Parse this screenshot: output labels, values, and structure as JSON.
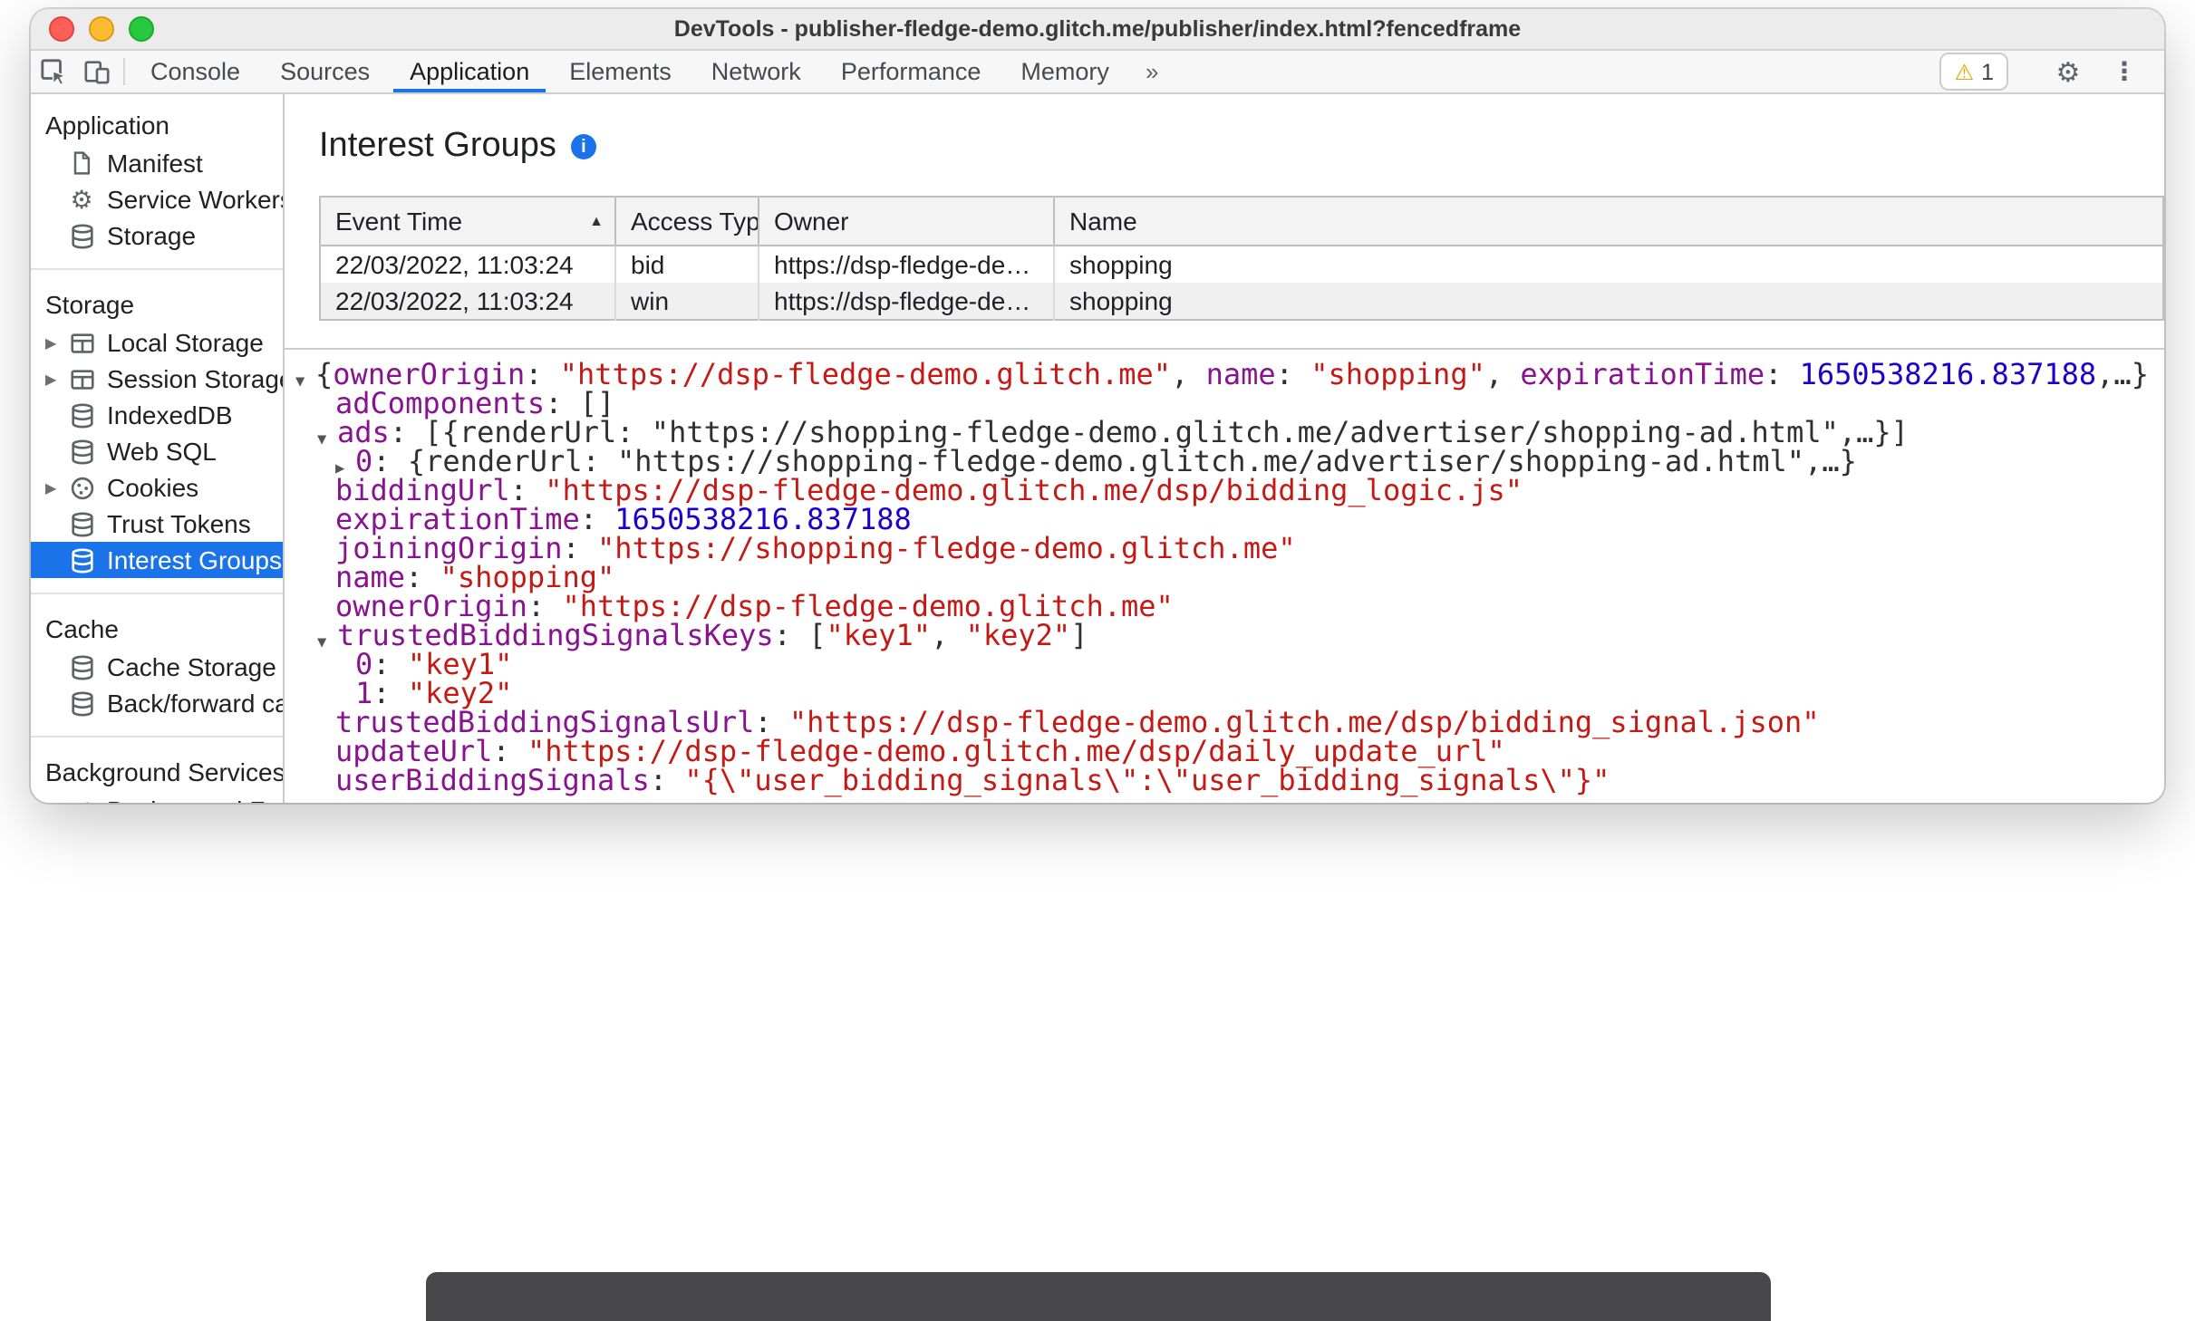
{
  "window": {
    "title": "DevTools - publisher-fledge-demo.glitch.me/publisher/index.html?fencedframe"
  },
  "toolbar": {
    "tabs": [
      "Console",
      "Sources",
      "Application",
      "Elements",
      "Network",
      "Performance",
      "Memory"
    ],
    "active_tab": "Application",
    "more_label": "»",
    "warning_count": "1"
  },
  "sidebar": {
    "sections": [
      {
        "header": "Application",
        "items": [
          {
            "label": "Manifest",
            "icon": "document"
          },
          {
            "label": "Service Workers",
            "icon": "gear"
          },
          {
            "label": "Storage",
            "icon": "database"
          }
        ]
      },
      {
        "header": "Storage",
        "items": [
          {
            "label": "Local Storage",
            "icon": "table",
            "expander": true
          },
          {
            "label": "Session Storage",
            "icon": "table",
            "expander": true
          },
          {
            "label": "IndexedDB",
            "icon": "database"
          },
          {
            "label": "Web SQL",
            "icon": "database"
          },
          {
            "label": "Cookies",
            "icon": "cookie",
            "expander": true
          },
          {
            "label": "Trust Tokens",
            "icon": "database"
          },
          {
            "label": "Interest Groups",
            "icon": "database",
            "selected": true
          }
        ]
      },
      {
        "header": "Cache",
        "items": [
          {
            "label": "Cache Storage",
            "icon": "database"
          },
          {
            "label": "Back/forward cache",
            "icon": "database"
          }
        ]
      },
      {
        "header": "Background Services",
        "items": [
          {
            "label": "Background Fetch",
            "icon": "updown"
          }
        ]
      }
    ]
  },
  "main": {
    "title": "Interest Groups",
    "table": {
      "columns": [
        "Event Time",
        "Access Type",
        "Owner",
        "Name"
      ],
      "sorted_column": "Event Time",
      "sort_indicator": "▲",
      "rows": [
        [
          "22/03/2022, 11:03:24",
          "bid",
          "https://dsp-fledge-demo.glitch.me",
          "shopping"
        ],
        [
          "22/03/2022, 11:03:24",
          "win",
          "https://dsp-fledge-demo.glitch.me",
          "shopping"
        ]
      ]
    },
    "tree": {
      "lines": [
        {
          "x": 10,
          "arrow": "v",
          "segs": [
            [
              "p",
              "{"
            ],
            [
              "k",
              "ownerOrigin"
            ],
            [
              "p",
              ": "
            ],
            [
              "s",
              "\"https://dsp-fledge-demo.glitch.me\""
            ],
            [
              "p",
              ", "
            ],
            [
              "k",
              "name"
            ],
            [
              "p",
              ": "
            ],
            [
              "s",
              "\"shopping\""
            ],
            [
              "p",
              ", "
            ],
            [
              "k",
              "expirationTime"
            ],
            [
              "p",
              ": "
            ],
            [
              "n",
              "1650538216.837188"
            ],
            [
              "p",
              ",…}"
            ]
          ]
        },
        {
          "x": 21,
          "arrow": null,
          "segs": [
            [
              "k",
              "adComponents"
            ],
            [
              "p",
              ": []"
            ]
          ]
        },
        {
          "x": 22,
          "arrow": "v",
          "segs": [
            [
              "k",
              "ads"
            ],
            [
              "p",
              ": [{renderUrl: \"https://shopping-fledge-demo.glitch.me/advertiser/shopping-ad.html\",…}]"
            ]
          ]
        },
        {
          "x": 32,
          "arrow": "r",
          "segs": [
            [
              "k",
              "0"
            ],
            [
              "p",
              ": {renderUrl: \"https://shopping-fledge-demo.glitch.me/advertiser/shopping-ad.html\",…}"
            ]
          ]
        },
        {
          "x": 21,
          "arrow": null,
          "segs": [
            [
              "k",
              "biddingUrl"
            ],
            [
              "p",
              ": "
            ],
            [
              "s",
              "\"https://dsp-fledge-demo.glitch.me/dsp/bidding_logic.js\""
            ]
          ]
        },
        {
          "x": 21,
          "arrow": null,
          "segs": [
            [
              "k",
              "expirationTime"
            ],
            [
              "p",
              ": "
            ],
            [
              "n",
              "1650538216.837188"
            ]
          ]
        },
        {
          "x": 21,
          "arrow": null,
          "segs": [
            [
              "k",
              "joiningOrigin"
            ],
            [
              "p",
              ": "
            ],
            [
              "s",
              "\"https://shopping-fledge-demo.glitch.me\""
            ]
          ]
        },
        {
          "x": 21,
          "arrow": null,
          "segs": [
            [
              "k",
              "name"
            ],
            [
              "p",
              ": "
            ],
            [
              "s",
              "\"shopping\""
            ]
          ]
        },
        {
          "x": 21,
          "arrow": null,
          "segs": [
            [
              "k",
              "ownerOrigin"
            ],
            [
              "p",
              ": "
            ],
            [
              "s",
              "\"https://dsp-fledge-demo.glitch.me\""
            ]
          ]
        },
        {
          "x": 22,
          "arrow": "v",
          "segs": [
            [
              "k",
              "trustedBiddingSignalsKeys"
            ],
            [
              "p",
              ": ["
            ],
            [
              "s",
              "\"key1\""
            ],
            [
              "p",
              ", "
            ],
            [
              "s",
              "\"key2\""
            ],
            [
              "p",
              "]"
            ]
          ]
        },
        {
          "x": 32,
          "arrow": null,
          "segs": [
            [
              "k",
              "0"
            ],
            [
              "p",
              ": "
            ],
            [
              "s",
              "\"key1\""
            ]
          ]
        },
        {
          "x": 32,
          "arrow": null,
          "segs": [
            [
              "k",
              "1"
            ],
            [
              "p",
              ": "
            ],
            [
              "s",
              "\"key2\""
            ]
          ]
        },
        {
          "x": 21,
          "arrow": null,
          "segs": [
            [
              "k",
              "trustedBiddingSignalsUrl"
            ],
            [
              "p",
              ": "
            ],
            [
              "s",
              "\"https://dsp-fledge-demo.glitch.me/dsp/bidding_signal.json\""
            ]
          ]
        },
        {
          "x": 21,
          "arrow": null,
          "segs": [
            [
              "k",
              "updateUrl"
            ],
            [
              "p",
              ": "
            ],
            [
              "s",
              "\"https://dsp-fledge-demo.glitch.me/dsp/daily_update_url\""
            ]
          ]
        },
        {
          "x": 21,
          "arrow": null,
          "segs": [
            [
              "k",
              "userBiddingSignals"
            ],
            [
              "p",
              ": "
            ],
            [
              "s",
              "\"{\\\"user_bidding_signals\\\":\\\"user_bidding_signals\\\"}\""
            ]
          ]
        }
      ]
    }
  },
  "colors": {
    "accent": "#1a73e8",
    "key": "#881391",
    "string": "#c41a16",
    "number": "#1c00cf",
    "warning": "#e8a200"
  }
}
